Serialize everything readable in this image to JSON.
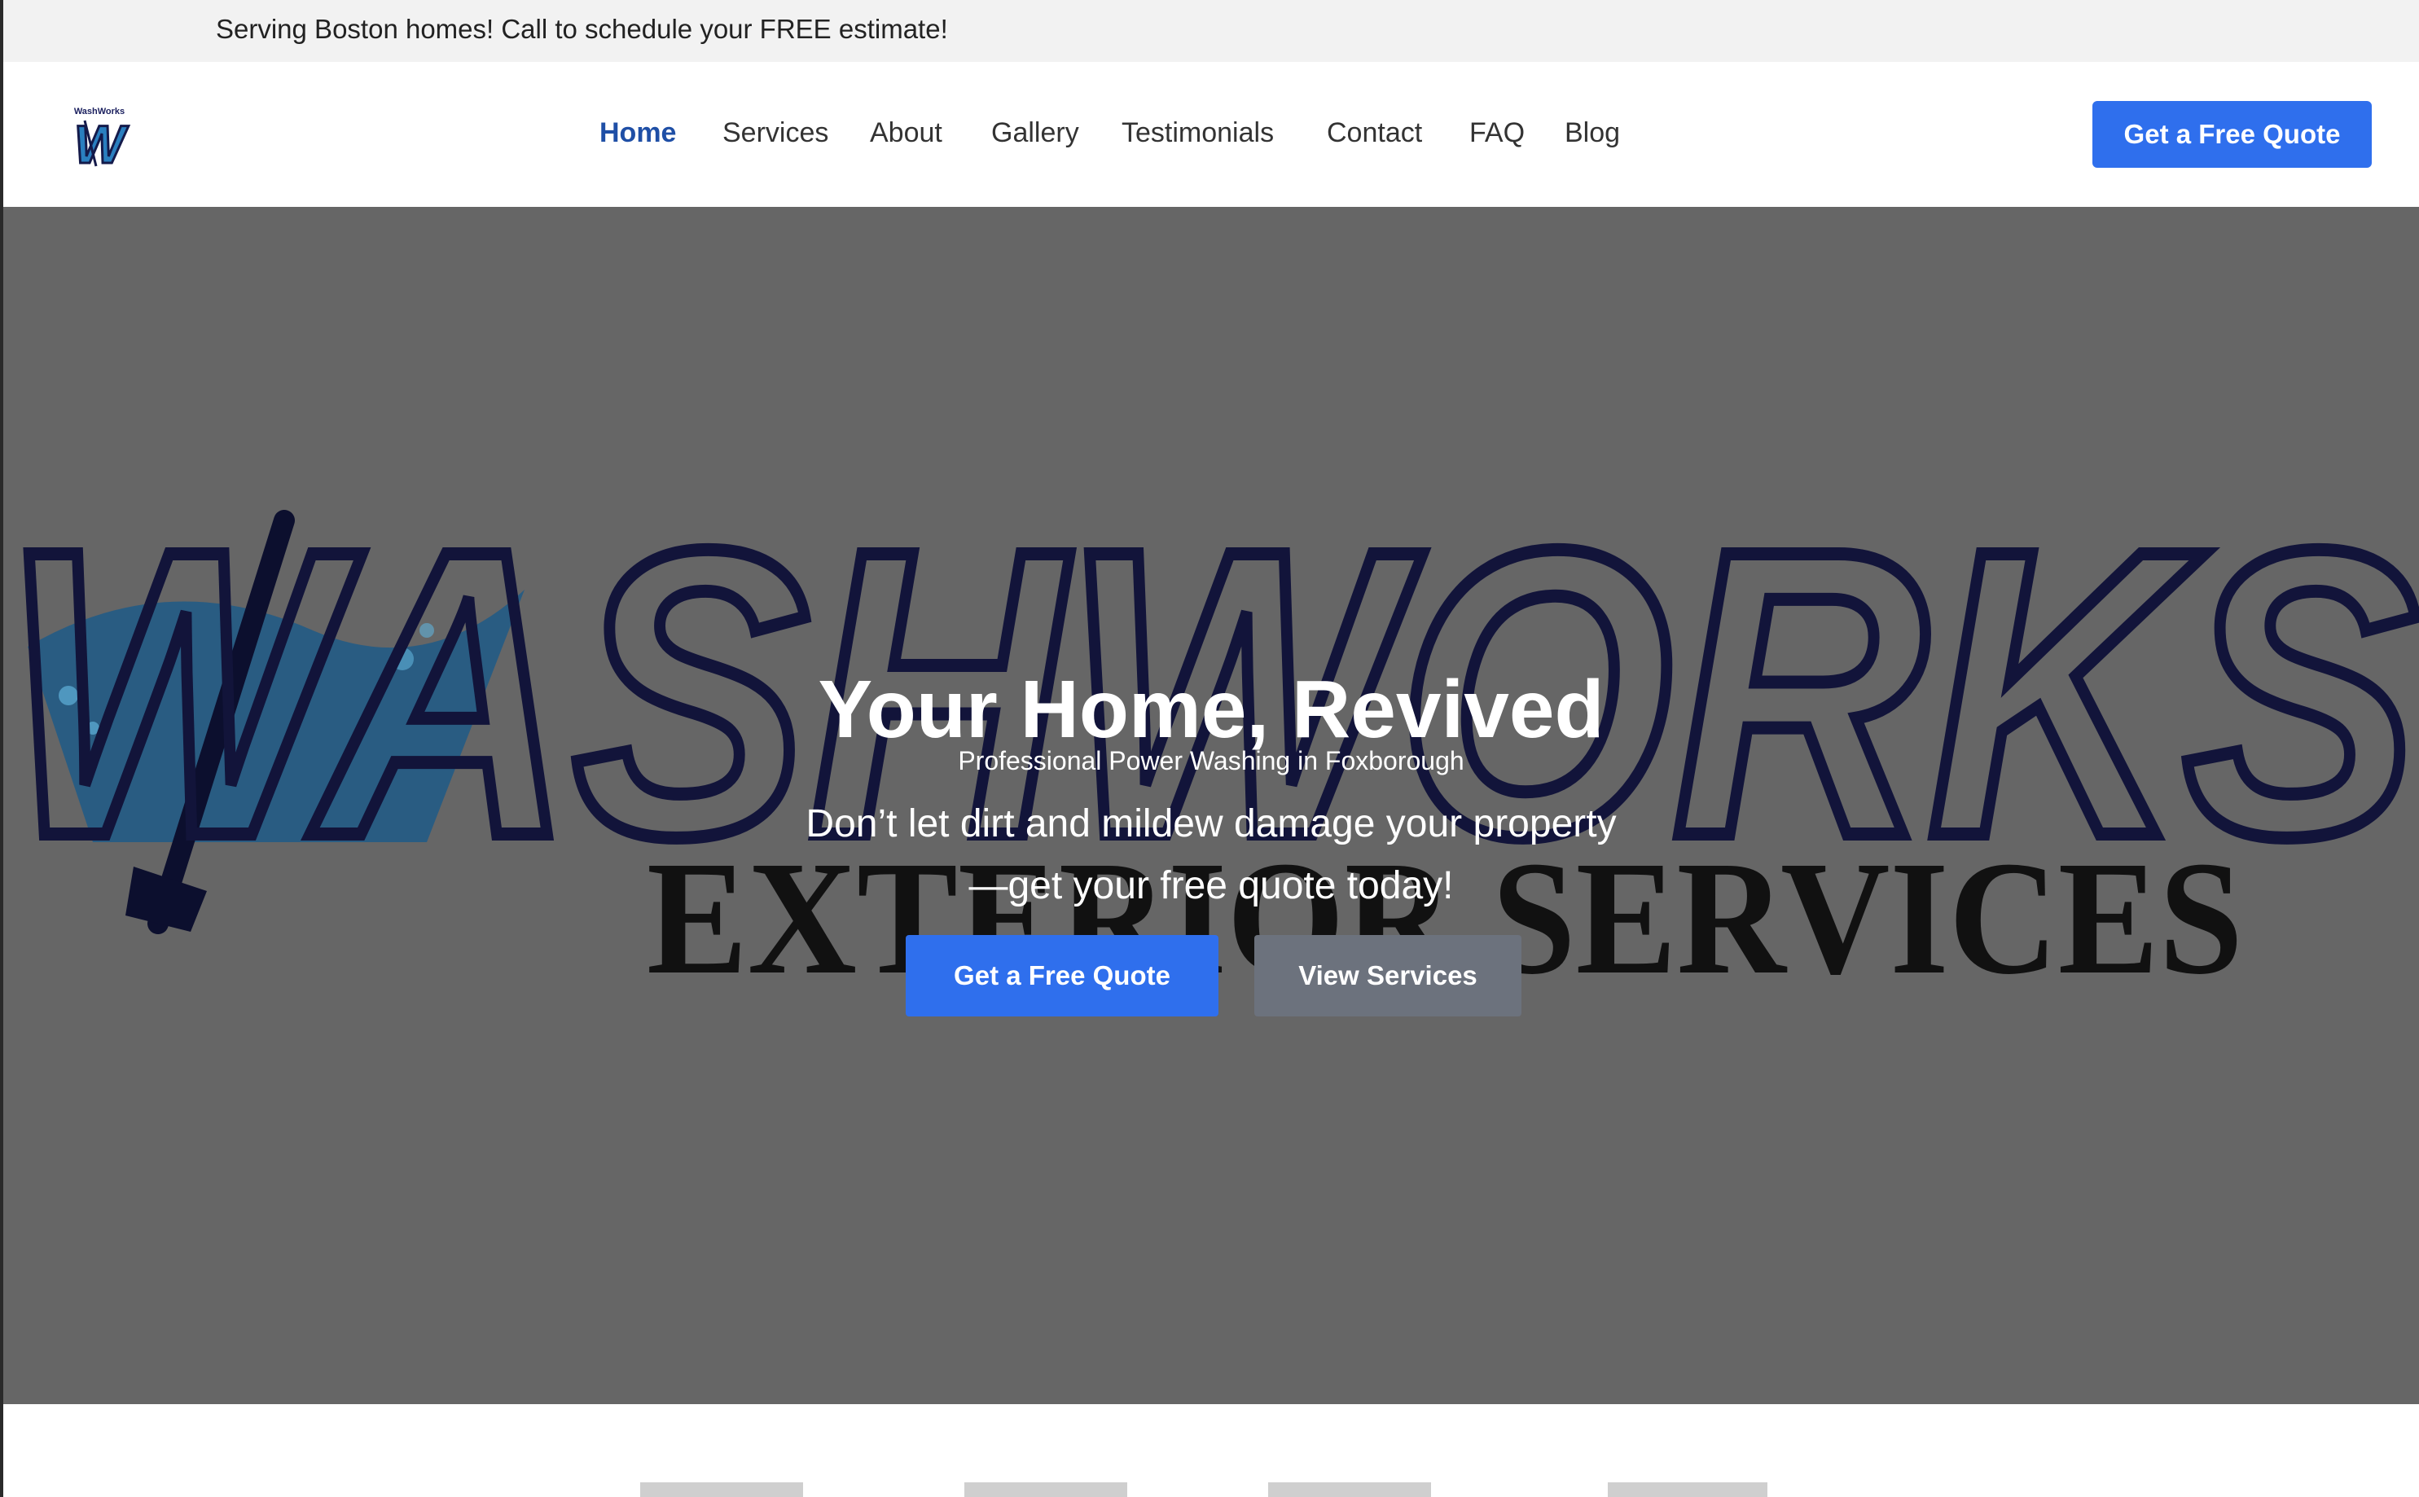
{
  "announcement": "Serving Boston homes! Call to schedule your FREE estimate!",
  "logo": {
    "text": "WashWorks",
    "letter": "W"
  },
  "nav": {
    "items": [
      {
        "label": "Home",
        "active": true
      },
      {
        "label": "Services",
        "active": false
      },
      {
        "label": "About",
        "active": false
      },
      {
        "label": "Gallery",
        "active": false
      },
      {
        "label": "Testimonials",
        "active": false
      },
      {
        "label": "Contact",
        "active": false
      },
      {
        "label": "FAQ",
        "active": false
      },
      {
        "label": "Blog",
        "active": false
      }
    ]
  },
  "header_cta": "Get a Free Quote",
  "hero": {
    "background_logo": {
      "word": "WASHWORKS",
      "sub": "EXTERIOR SERVICES"
    },
    "title": "Your Home, Revived",
    "subtitle": "Professional Power Washing in Foxborough",
    "tagline_line1": "Don’t let dirt and mildew damage your property",
    "tagline_line2": "—get your free quote today!",
    "primary_button": "Get a Free Quote",
    "secondary_button": "View Services"
  },
  "colors": {
    "accent": "#2f6fed",
    "nav_active": "#1f4fa6",
    "hero_overlay": "#666666",
    "secondary_button": "#6c727d"
  }
}
